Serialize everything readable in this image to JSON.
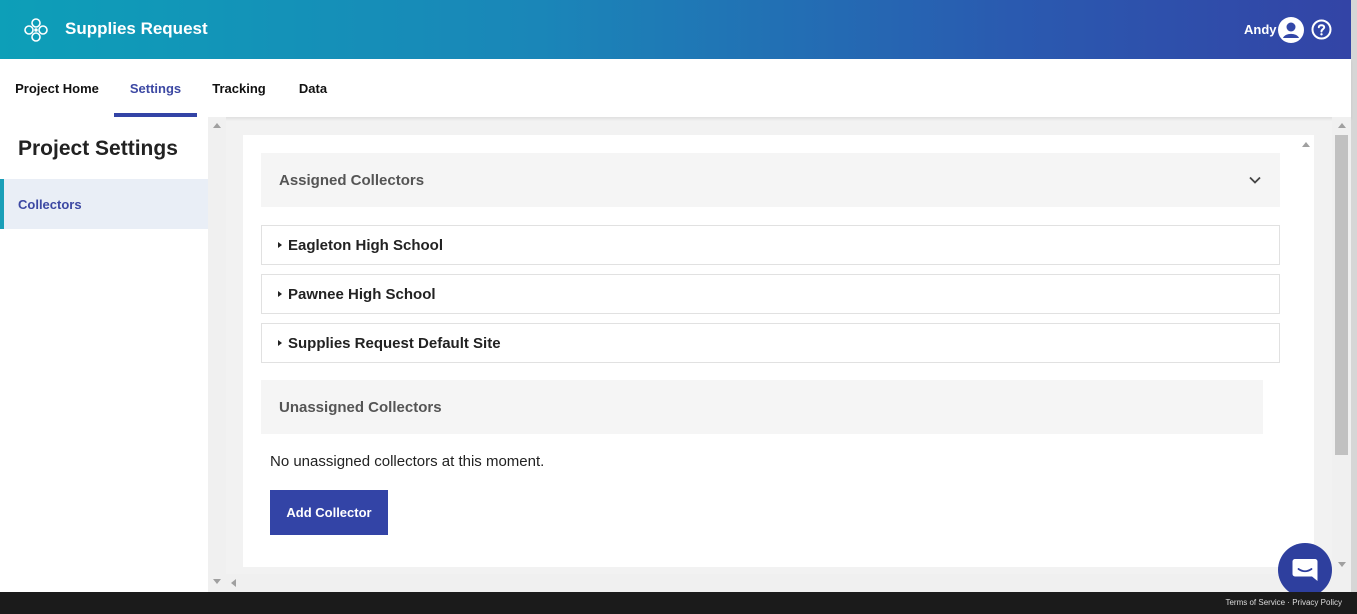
{
  "header": {
    "app_title": "Supplies Request",
    "user_name": "Andy",
    "logo_icon": "flower-logo-icon",
    "user_icon": "user-circle-icon",
    "help_icon": "help-circle-icon"
  },
  "nav": {
    "tabs": [
      {
        "label": "Project Home",
        "active": false
      },
      {
        "label": "Settings",
        "active": true
      },
      {
        "label": "Tracking",
        "active": false
      },
      {
        "label": "Data",
        "active": false
      }
    ]
  },
  "sidebar": {
    "title": "Project Settings",
    "items": [
      {
        "label": "Collectors",
        "active": true
      }
    ]
  },
  "main": {
    "assigned_header": "Assigned Collectors",
    "sites": [
      {
        "name": "Eagleton High School"
      },
      {
        "name": "Pawnee High School"
      },
      {
        "name": "Supplies Request Default Site"
      }
    ],
    "unassigned_header": "Unassigned Collectors",
    "unassigned_empty": "No unassigned collectors at this moment.",
    "add_button_label": "Add Collector"
  },
  "footer": {
    "terms": "Terms of Service",
    "separator": "·",
    "privacy": "Privacy Policy"
  },
  "colors": {
    "brand_primary": "#3344a6",
    "brand_teal": "#0d9fb8",
    "active_tab_text": "#3c48a3"
  }
}
